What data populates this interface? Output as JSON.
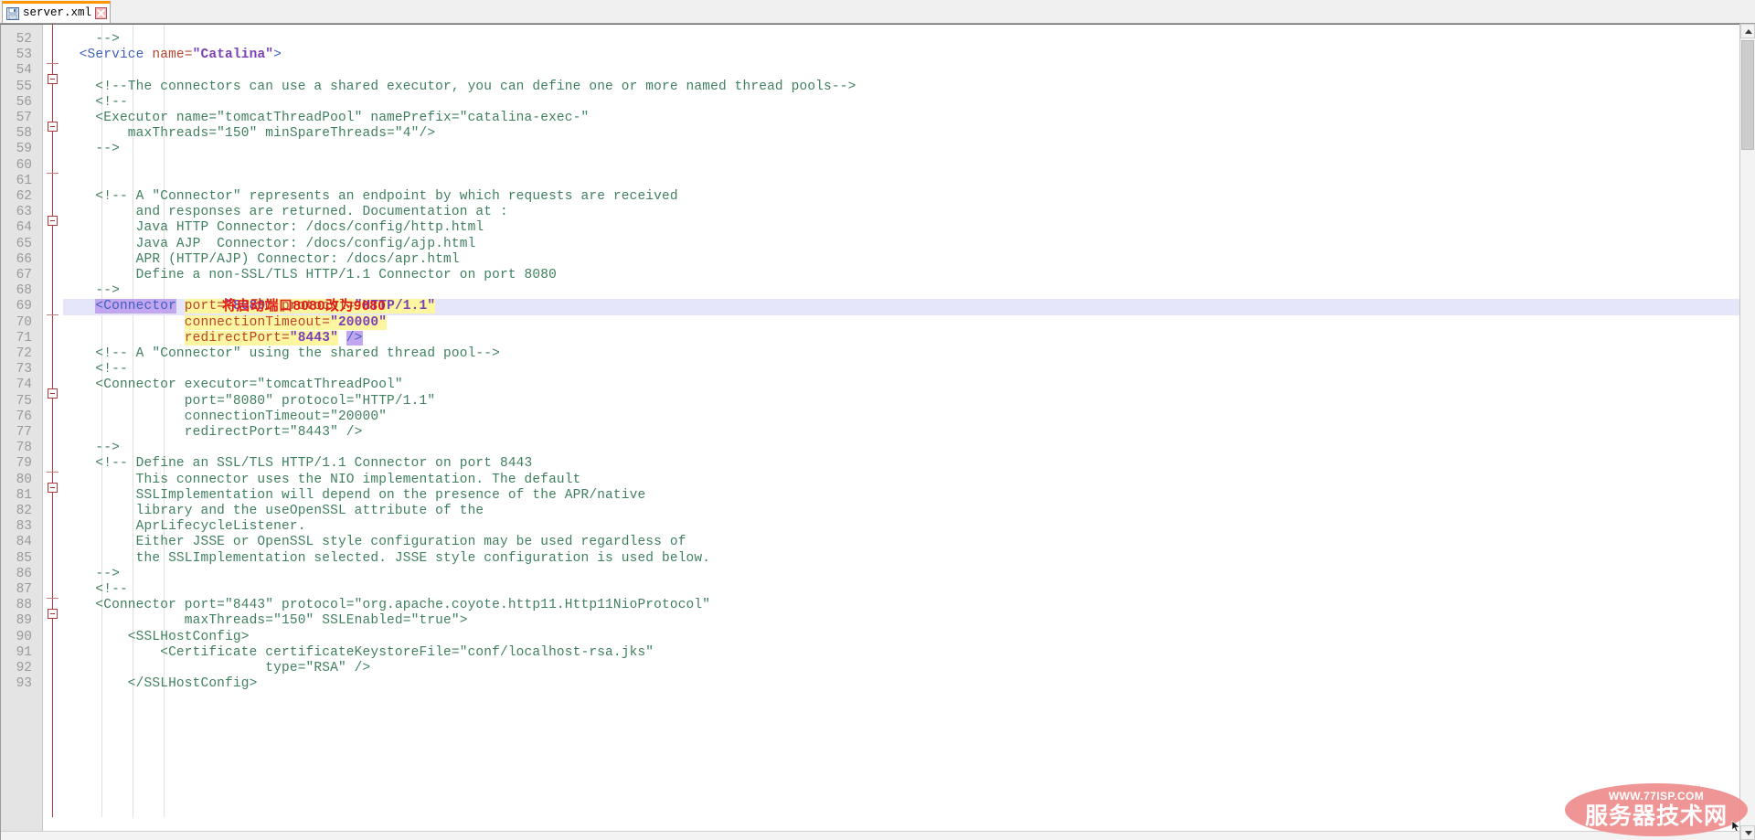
{
  "window": {
    "title": "server.xml"
  },
  "tab": {
    "label": "server.xml",
    "save_icon": "floppy-disk-icon",
    "close_icon": "close-icon",
    "accent_color": "#ff9500"
  },
  "annotation": {
    "text": "将启动端口8080改为9080",
    "color": "#e01b1b"
  },
  "watermark": {
    "url": "WWW.77ISP.COM",
    "name": "服务器技术网",
    "faint": "http://",
    "ellipse_color": "#ef8d8d"
  },
  "colors": {
    "comment": "#3f7f5f",
    "tag": "#3f5fbf",
    "attribute": "#b8432e",
    "value": "#7b3fb8",
    "selection": "#c3a6f0",
    "search_match": "#fdf6a0",
    "current_line": "#e6e6fa",
    "gutter_bg": "#e4e4e4",
    "fold_line": "#b03a3a"
  },
  "editor": {
    "first_visible_line": 52,
    "last_visible_line": 93,
    "current_line": 69,
    "lines": [
      {
        "n": 52,
        "fold": "tick",
        "tokens": [
          {
            "t": "    ",
            "c": "plain"
          },
          {
            "t": "-->",
            "c": "comment"
          }
        ]
      },
      {
        "n": 53,
        "fold": "box",
        "tokens": [
          {
            "t": "  ",
            "c": "plain"
          },
          {
            "t": "<Service ",
            "c": "tag"
          },
          {
            "t": "name=",
            "c": "attr"
          },
          {
            "t": "\"Catalina\"",
            "c": "val"
          },
          {
            "t": ">",
            "c": "tag"
          }
        ]
      },
      {
        "n": 54,
        "fold": "",
        "tokens": []
      },
      {
        "n": 55,
        "fold": "",
        "tokens": [
          {
            "t": "    <!--The connectors can use a shared executor, you can define one or more named thread pools-->",
            "c": "comment"
          }
        ]
      },
      {
        "n": 56,
        "fold": "box",
        "tokens": [
          {
            "t": "    <!--",
            "c": "comment"
          }
        ]
      },
      {
        "n": 57,
        "fold": "",
        "tokens": [
          {
            "t": "    <Executor name=\"tomcatThreadPool\" namePrefix=\"catalina-exec-\"",
            "c": "comment"
          }
        ]
      },
      {
        "n": 58,
        "fold": "",
        "tokens": [
          {
            "t": "        maxThreads=\"150\" minSpareThreads=\"4\"/>",
            "c": "comment"
          }
        ]
      },
      {
        "n": 59,
        "fold": "tick",
        "tokens": [
          {
            "t": "    -->",
            "c": "comment"
          }
        ]
      },
      {
        "n": 60,
        "fold": "",
        "tokens": []
      },
      {
        "n": 61,
        "fold": "",
        "tokens": []
      },
      {
        "n": 62,
        "fold": "box",
        "tokens": [
          {
            "t": "    <!-- A \"Connector\" represents an endpoint by which requests are received",
            "c": "comment"
          }
        ]
      },
      {
        "n": 63,
        "fold": "",
        "tokens": [
          {
            "t": "         and responses are returned. Documentation at :",
            "c": "comment"
          }
        ]
      },
      {
        "n": 64,
        "fold": "",
        "tokens": [
          {
            "t": "         Java HTTP Connector: /docs/config/http.html",
            "c": "comment"
          }
        ]
      },
      {
        "n": 65,
        "fold": "",
        "tokens": [
          {
            "t": "         Java AJP  Connector: /docs/config/ajp.html",
            "c": "comment"
          }
        ]
      },
      {
        "n": 66,
        "fold": "",
        "tokens": [
          {
            "t": "         APR (HTTP/AJP) Connector: /docs/apr.html",
            "c": "comment"
          }
        ]
      },
      {
        "n": 67,
        "fold": "",
        "tokens": [
          {
            "t": "         Define a non-SSL/TLS HTTP/1.1 Connector on port 8080",
            "c": "comment"
          }
        ]
      },
      {
        "n": 68,
        "fold": "tick",
        "tokens": [
          {
            "t": "    -->",
            "c": "comment"
          }
        ]
      },
      {
        "n": 69,
        "fold": "",
        "current": true,
        "tokens": [
          {
            "t": "    ",
            "c": "plain"
          },
          {
            "t": "<Connector",
            "c": "tag",
            "hl": "sel"
          },
          {
            "t": " ",
            "c": "plain"
          },
          {
            "t": "port=",
            "c": "attr",
            "hl": "yellow"
          },
          {
            "t": "\"8080\"",
            "c": "val",
            "hl": "yellow"
          },
          {
            "t": " ",
            "c": "plain",
            "hl": "yellow"
          },
          {
            "t": "protocol=",
            "c": "attr",
            "hl": "yellow"
          },
          {
            "t": "\"HTTP/1.1\"",
            "c": "val",
            "hl": "yellow"
          }
        ]
      },
      {
        "n": 70,
        "fold": "",
        "tokens": [
          {
            "t": "               ",
            "c": "plain"
          },
          {
            "t": "connectionTimeout=",
            "c": "attr",
            "hl": "yellow"
          },
          {
            "t": "\"20000\"",
            "c": "val",
            "hl": "yellow"
          }
        ]
      },
      {
        "n": 71,
        "fold": "",
        "tokens": [
          {
            "t": "               ",
            "c": "plain"
          },
          {
            "t": "redirectPort=",
            "c": "attr",
            "hl": "yellow"
          },
          {
            "t": "\"8443\"",
            "c": "val",
            "hl": "yellow"
          },
          {
            "t": " ",
            "c": "plain"
          },
          {
            "t": "/>",
            "c": "tag",
            "hl": "sel"
          }
        ]
      },
      {
        "n": 72,
        "fold": "",
        "tokens": [
          {
            "t": "    <!-- A \"Connector\" using the shared thread pool-->",
            "c": "comment"
          }
        ]
      },
      {
        "n": 73,
        "fold": "box",
        "tokens": [
          {
            "t": "    <!--",
            "c": "comment"
          }
        ]
      },
      {
        "n": 74,
        "fold": "",
        "tokens": [
          {
            "t": "    <Connector executor=\"tomcatThreadPool\"",
            "c": "comment"
          }
        ]
      },
      {
        "n": 75,
        "fold": "",
        "tokens": [
          {
            "t": "               port=\"8080\" protocol=\"HTTP/1.1\"",
            "c": "comment"
          }
        ]
      },
      {
        "n": 76,
        "fold": "",
        "tokens": [
          {
            "t": "               connectionTimeout=\"20000\"",
            "c": "comment"
          }
        ]
      },
      {
        "n": 77,
        "fold": "",
        "tokens": [
          {
            "t": "               redirectPort=\"8443\" />",
            "c": "comment"
          }
        ]
      },
      {
        "n": 78,
        "fold": "tick",
        "tokens": [
          {
            "t": "    -->",
            "c": "comment"
          }
        ]
      },
      {
        "n": 79,
        "fold": "box",
        "tokens": [
          {
            "t": "    <!-- Define an SSL/TLS HTTP/1.1 Connector on port 8443",
            "c": "comment"
          }
        ]
      },
      {
        "n": 80,
        "fold": "",
        "tokens": [
          {
            "t": "         This connector uses the NIO implementation. The default",
            "c": "comment"
          }
        ]
      },
      {
        "n": 81,
        "fold": "",
        "tokens": [
          {
            "t": "         SSLImplementation will depend on the presence of the APR/native",
            "c": "comment"
          }
        ]
      },
      {
        "n": 82,
        "fold": "",
        "tokens": [
          {
            "t": "         library and the useOpenSSL attribute of the",
            "c": "comment"
          }
        ]
      },
      {
        "n": 83,
        "fold": "",
        "tokens": [
          {
            "t": "         AprLifecycleListener.",
            "c": "comment"
          }
        ]
      },
      {
        "n": 84,
        "fold": "",
        "tokens": [
          {
            "t": "         Either JSSE or OpenSSL style configuration may be used regardless of",
            "c": "comment"
          }
        ]
      },
      {
        "n": 85,
        "fold": "",
        "tokens": [
          {
            "t": "         the SSLImplementation selected. JSSE style configuration is used below.",
            "c": "comment"
          }
        ]
      },
      {
        "n": 86,
        "fold": "tick",
        "tokens": [
          {
            "t": "    -->",
            "c": "comment"
          }
        ]
      },
      {
        "n": 87,
        "fold": "box",
        "tokens": [
          {
            "t": "    <!--",
            "c": "comment"
          }
        ]
      },
      {
        "n": 88,
        "fold": "",
        "tokens": [
          {
            "t": "    <Connector port=\"8443\" protocol=\"org.apache.coyote.http11.Http11NioProtocol\"",
            "c": "comment"
          }
        ]
      },
      {
        "n": 89,
        "fold": "",
        "tokens": [
          {
            "t": "               maxThreads=\"150\" SSLEnabled=\"true\">",
            "c": "comment"
          }
        ]
      },
      {
        "n": 90,
        "fold": "",
        "tokens": [
          {
            "t": "        <SSLHostConfig>",
            "c": "comment"
          }
        ]
      },
      {
        "n": 91,
        "fold": "",
        "tokens": [
          {
            "t": "            <Certificate certificateKeystoreFile=\"conf/localhost-rsa.jks\"",
            "c": "comment"
          }
        ]
      },
      {
        "n": 92,
        "fold": "",
        "tokens": [
          {
            "t": "                         type=\"RSA\" />",
            "c": "comment"
          }
        ]
      },
      {
        "n": 93,
        "fold": "",
        "tokens": [
          {
            "t": "        </SSLHostConfig>",
            "c": "comment"
          }
        ]
      }
    ]
  },
  "scrollbar": {
    "up_arrow": "chevron-up-icon",
    "down_arrow": "chevron-down-icon"
  }
}
